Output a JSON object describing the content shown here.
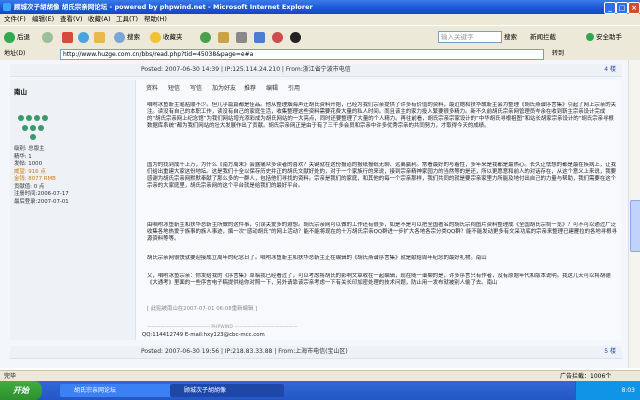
{
  "window": {
    "title": "顾城次子胡胡像 胡氏宗亲网论坛 - powered by phpwind.net - Microsoft Internet Explorer",
    "minimize": "_",
    "maximize": "□",
    "close": "×"
  },
  "menu": [
    "文件(F)",
    "编辑(E)",
    "查看(V)",
    "收藏(A)",
    "工具(T)",
    "帮助(H)"
  ],
  "toolbar": {
    "back": "后退",
    "search": "搜索",
    "favorites": "收藏夹",
    "search_box_placeholder": "输入关键字",
    "search_btn": "搜索",
    "news_label": "新闻拦截",
    "security": "安全助手"
  },
  "address": {
    "label": "地址(D)",
    "url": "http://www.huzge.com.cn/bbs/read.php?tid=45038&page=e#a",
    "go": "转到"
  },
  "posts": {
    "top_bar": "Posted: 2007-06-30 14:39 | IP:125.114.24.210 | From:浙江省宁波市电信 ",
    "floor1": "4 楼",
    "author": {
      "name": "南山",
      "level": "级别: 总版主",
      "posts": "精华: 1",
      "post_count": "发帖: 1000",
      "reputation": "威望: 916 点",
      "money": "金钱: 8077 RMB",
      "contrib": "贡献值: 0 点",
      "reg": "注册时间:2006-07-17",
      "last": "最后登录:2007-07-01"
    },
    "actions": [
      "资料",
      "短信",
      "写信",
      "加为好友",
      "推荐",
      "编辑",
      "引用"
    ],
    "p1": "    咱咐冰鱼靳主笔贴顺不少。但几乎篇篇都是佳品。他从整理烟海声迁胡氏资料开始，已经为我们宗亲提供了许多有价值的资料，最近她和扶华故靳主会为整理《胡氏燕谱序言集》引起了网上宗亲的关注。读没有自己的本职工作，读没有自己的家庭生活，收集整理这些资料需要花费大量的私人时间。而且该主的家力投入繁要很多精力。新不久前胡氏宗亲网管理员岑余在收到靳主宗亲设计完成的“胡氏宗亲网上纪念馆”为我们网站增光添彩成为胡氏网站的一大亮点，同时还要整理了大量的个人精力。再往前看，胡氏宗亲宗家设计的“中华胡氏寻根祖图”和站长胡家宗亲设计的“胡氏宗亲寻根数据库系统”都为我们网站的壮大发展作出了贡献。胡氏宗亲网正是由于有了三千多会员和宗亲中许多优秀宗亲的共同努力，才取得今天的成绩。",
    "p2": "    国为的找到成千上万，为什么《南方周末》会露痛众多读者的喜欢？关键就在这份报道的报纸报纸无聊、远离赢利。常看最好的写着性，多年来是我都是最热心。长久让怯想的都是最在疾病上，让我们给出重建大家这份地坛。这是我们十全以保存历史并正的胡氏文献好处的，对于一个家族行的来说，接到宗亲精神家园力的当然等的是还，所以更愿意和前人的对话存在，从这个意义上来说，我要感谢为胡氏宗亲网默默奉献了那么多的一群人，包括他们寻找的资料。宗亲是我们的家庭，和其他的每一个宗亲那样，我们共同的就是要宗亲家里力所能及地付出自己的力量与帮助，我们需要在这个宗亲的大家庭里，胡氏宗亲网的这个平台就是给我们的最好平台。",
    "p3": "    由咱咐冰鱼靳主和扶华总靳主所做的这件事，引误关爱多的遐想。胡氏宗亲网可以做的工作还有很多，如是不是可以把全国著名的胡氏宗祠图片资料整理成《全国胡氏宗祠一览》？可不可以通过广泛收集各地热爱于族事的族人事迹，撰一次“感动胡氏”的网上活动？能不能将现在的十万胡氏宗亲QQ群进一步扩大各地各宗分类QQ群？能不能发动更多有文采功底的宗亲来整理已建雁拉的各地寻根寻源资料等等。",
    "p4": "    胡氏宗亲网很快就要迎接成立周年的纪念日了。咱咐冰鱼靳主和扶华总靳主正在编辑的《胡氏燕谱序言集》就是献给周年纪念的最好礼物。南山",
    "p5": "    又，咱咐冰鱼宗亲：你发给我的《序言集》草稿我已经看过了，可以考虑将胡氏的影响文章收在一起编辑，现在随一谱撷的是，许多序言只有作者，没有原题年代和版本说明。我这几天可以将胡德《大通考》里面的一些序言电子稿提供给你对照一下，另外请靠该宗亲考虑一下有关长印加密处理的技术问题，防止用一发布就被别人偷了去。南山",
    "edit_note": "[ 此贴被南山在2007-07-01 06:08重新编辑 ]",
    "sig_divider": "—————————————— PHPWIND ——————————————",
    "sig_contact": "QQ:114412749   E-mail:hxy123@cbc-mcc.com",
    "bottom_bar": "Posted: 2007-06-30 19:56 | IP:218.83.33.88 | From:上海市电信(宝山区) ",
    "floor2": "5 楼"
  },
  "status": {
    "left": "完毕",
    "right": "广告拦截：1006个"
  },
  "taskbar": {
    "start": "开始",
    "task1": "胡氏宗亲网论坛",
    "task2": "顾城次子胡胡像",
    "clock": "8:03"
  },
  "colors": {
    "accent": "#1b56d6",
    "link": "#1d4aa0",
    "content_bg": "#f3f6fa"
  }
}
